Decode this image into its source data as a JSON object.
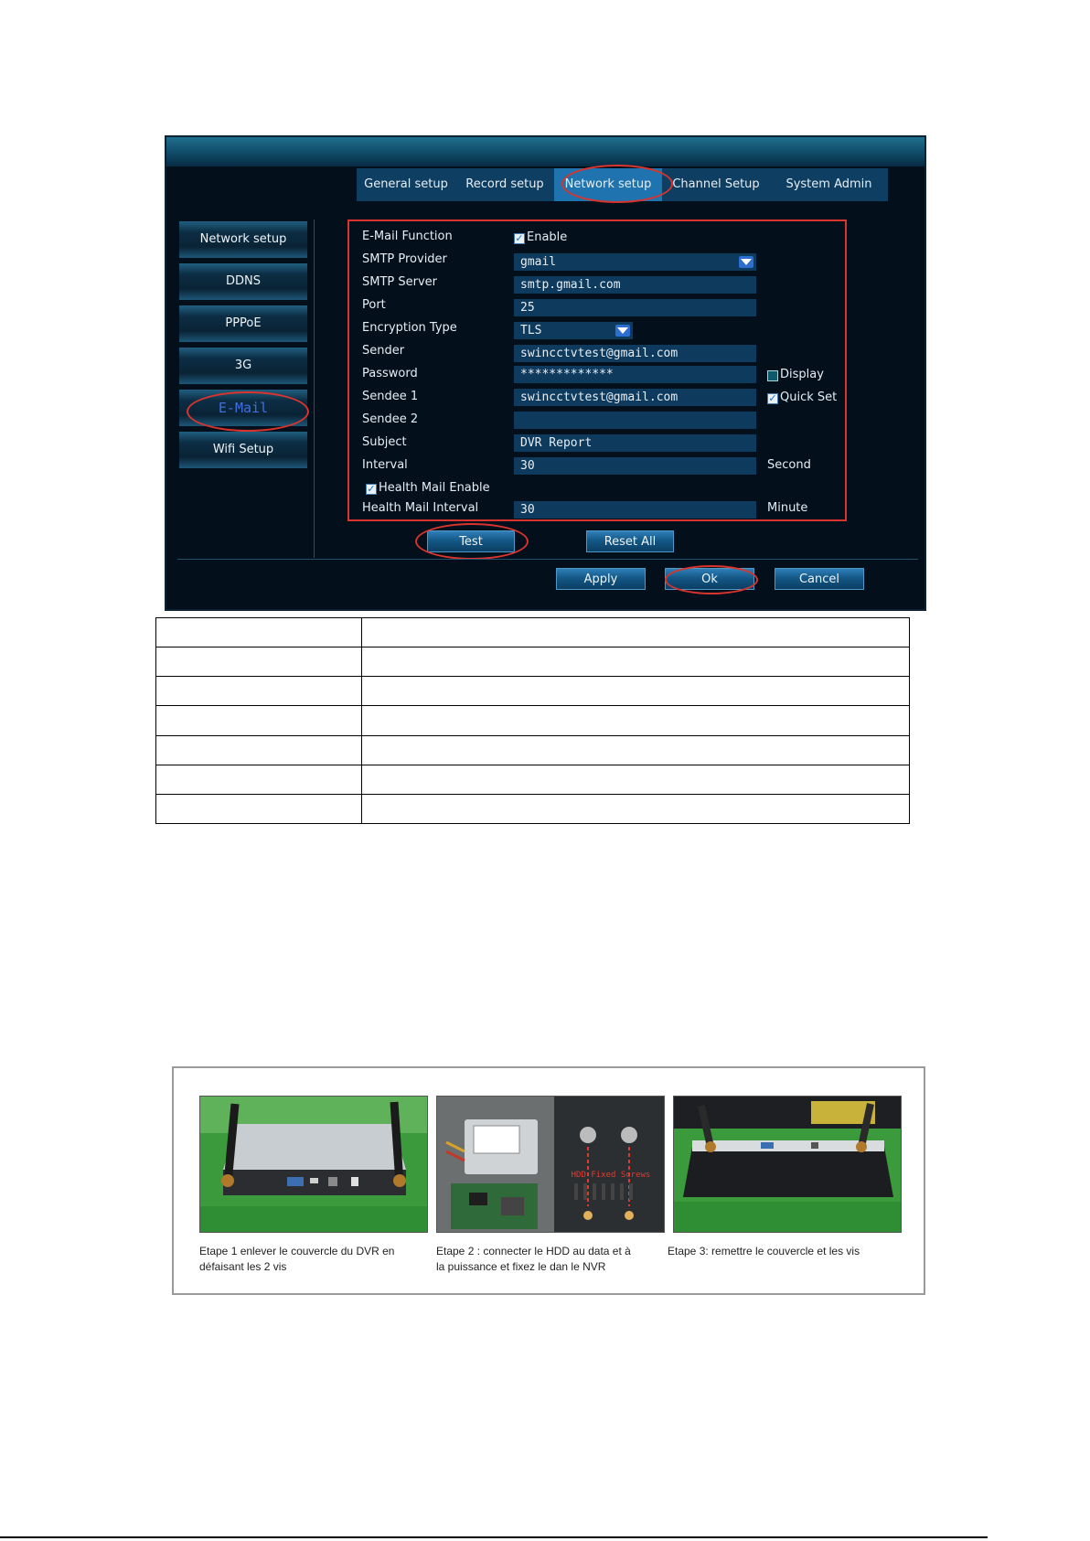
{
  "tabs": [
    {
      "label": "General setup",
      "active": false
    },
    {
      "label": "Record setup",
      "active": false
    },
    {
      "label": "Network setup",
      "active": true
    },
    {
      "label": "Channel Setup",
      "active": false
    },
    {
      "label": "System Admin",
      "active": false
    }
  ],
  "sidebar": {
    "items": [
      {
        "label": "Network setup",
        "active": false
      },
      {
        "label": "DDNS",
        "active": false
      },
      {
        "label": "PPPoE",
        "active": false
      },
      {
        "label": "3G",
        "active": false
      },
      {
        "label": "E-Mail",
        "active": true
      },
      {
        "label": "Wifi Setup",
        "active": false
      }
    ]
  },
  "email_form": {
    "email_function": {
      "label": "E-Mail Function",
      "checkbox_label": "Enable",
      "checked": true
    },
    "smtp_provider": {
      "label": "SMTP Provider",
      "value": "gmail"
    },
    "smtp_server": {
      "label": "SMTP Server",
      "value": "smtp.gmail.com"
    },
    "port": {
      "label": "Port",
      "value": "25"
    },
    "encryption_type": {
      "label": "Encryption Type",
      "value": "TLS"
    },
    "sender": {
      "label": "Sender",
      "value": "swincctvtest@gmail.com"
    },
    "password": {
      "label": "Password",
      "value": "*************",
      "display_label": "Display",
      "display_checked": false
    },
    "sendee1": {
      "label": "Sendee 1",
      "value": "swincctvtest@gmail.com",
      "quick_set_label": "Quick Set",
      "quick_set_checked": true
    },
    "sendee2": {
      "label": "Sendee 2",
      "value": ""
    },
    "subject": {
      "label": "Subject",
      "value": "DVR Report"
    },
    "interval": {
      "label": "Interval",
      "value": "30",
      "unit": "Second"
    },
    "health_mail_enable": {
      "label": "Health Mail Enable",
      "checked": true
    },
    "health_mail_interval": {
      "label": "Health Mail Interval",
      "value": "30",
      "unit": "Minute"
    }
  },
  "buttons": {
    "test": "Test",
    "reset_all": "Reset All",
    "apply": "Apply",
    "ok": "Ok",
    "cancel": "Cancel"
  },
  "colors": {
    "highlight_ring": "#d9342d",
    "screen_bg": "#040f1c",
    "active_tab": "#1f73ae",
    "field_bg": "#0e3a5e"
  },
  "blank_table": {
    "rows": 7,
    "cols": 2
  },
  "steps": [
    {
      "caption_line1": "Etape 1 enlever le couvercle du DVR en",
      "caption_line2": "défaisant les 2 vis"
    },
    {
      "caption_line1": "Etape 2 : connecter le HDD au data et à",
      "caption_line2": "la puissance et fixez le dan le NVR",
      "photo_label": "HDD Fixed Screws"
    },
    {
      "caption_line1": "Etape 3: remettre le couvercle et les vis",
      "caption_line2": ""
    }
  ]
}
